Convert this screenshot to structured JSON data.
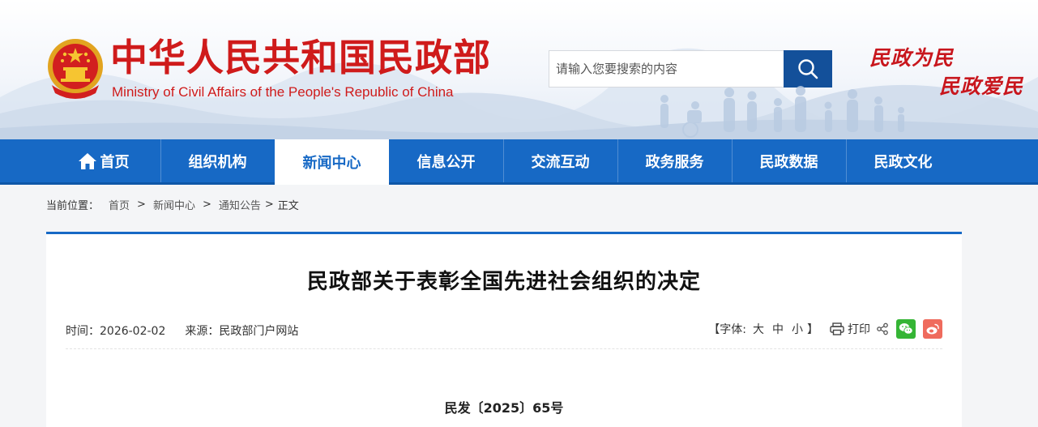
{
  "header": {
    "site_title": "中华人民共和国民政部",
    "site_subtitle": "Ministry of Civil Affairs of the People's Republic of China",
    "slogan_line1": "民政为民",
    "slogan_line2": "民政爱民",
    "emblem_icon": "national-emblem-icon"
  },
  "search": {
    "placeholder": "请输入您要搜索的内容",
    "button_icon": "search-icon"
  },
  "nav": {
    "items": [
      {
        "label": "首页",
        "icon": "home-icon"
      },
      {
        "label": "组织机构"
      },
      {
        "label": "新闻中心",
        "active": true
      },
      {
        "label": "信息公开"
      },
      {
        "label": "交流互动"
      },
      {
        "label": "政务服务"
      },
      {
        "label": "民政数据"
      },
      {
        "label": "民政文化"
      }
    ]
  },
  "breadcrumb": {
    "label": "当前位置：",
    "items": [
      "首页",
      "新闻中心",
      "通知公告",
      "正文"
    ],
    "separator": ">"
  },
  "article": {
    "title": "民政部关于表彰全国先进社会组织的决定",
    "time_label": "时间：",
    "time_value": "2026-02-02",
    "source_label": "来源：",
    "source_value": "民政部门户网站",
    "font_size_open": "【字体:",
    "font_sizes": [
      "大",
      "中",
      "小"
    ],
    "font_size_close": "】",
    "print_label": "打印",
    "doc_number": "民发〔2025〕65号"
  },
  "colors": {
    "brand_red": "#cf1b1b",
    "nav_blue": "#1769c5",
    "search_blue": "#13509a",
    "wechat_green": "#35b535",
    "weibo_red": "#ef6b5d"
  }
}
